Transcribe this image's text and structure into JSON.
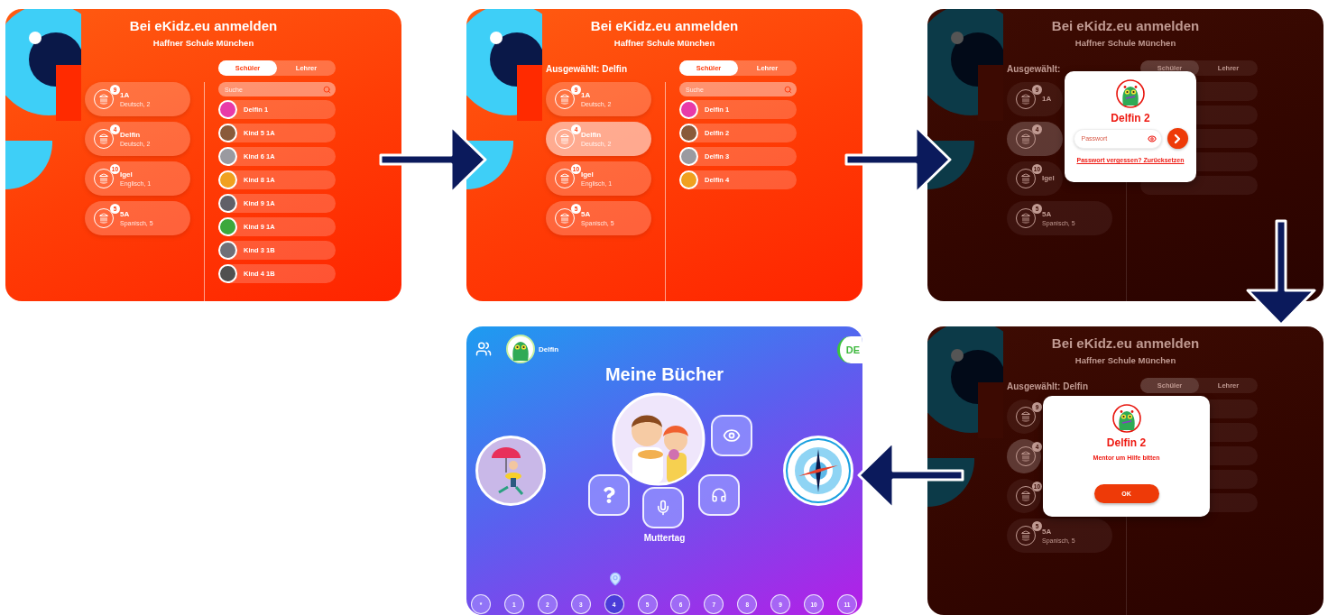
{
  "screens": [
    {
      "kind": "login",
      "dimmed": false,
      "title": "Bei eKidz.eu anmelden",
      "subtitle": "Haffner Schule München",
      "tabs": [
        {
          "label": "Schüler",
          "selected": true
        },
        {
          "label": "Lehrer",
          "selected": false
        }
      ],
      "search": {
        "placeholder": "Suche"
      },
      "classes": [
        {
          "name": "1A",
          "subject": "Deutsch, 2",
          "count": "9",
          "selected": false
        },
        {
          "name": "Delfin",
          "subject": "Deutsch, 2",
          "count": "4",
          "selected": false
        },
        {
          "name": "Igel",
          "subject": "Englisch, 1",
          "count": "10",
          "selected": false
        },
        {
          "name": "5A",
          "subject": "Spanisch, 5",
          "count": "5",
          "selected": false
        }
      ],
      "students": [
        {
          "name": "Delfin 1"
        },
        {
          "name": "Kind 5 1A"
        },
        {
          "name": "Kind 6 1A"
        },
        {
          "name": "Kind 8 1A"
        },
        {
          "name": "Kind 9 1A"
        },
        {
          "name": "Kind 9 1A"
        },
        {
          "name": "Kind 3 1B"
        },
        {
          "name": "Kind 4 1B"
        }
      ]
    },
    {
      "kind": "login",
      "dimmed": false,
      "title": "Bei eKidz.eu anmelden",
      "subtitle": "Haffner Schule München",
      "selected_label": "Ausgewählt: Delfin",
      "tabs": [
        {
          "label": "Schüler",
          "selected": true
        },
        {
          "label": "Lehrer",
          "selected": false
        }
      ],
      "search": {
        "placeholder": "Suche"
      },
      "classes": [
        {
          "name": "1A",
          "subject": "Deutsch, 2",
          "count": "9",
          "selected": false
        },
        {
          "name": "Delfin",
          "subject": "Deutsch, 2",
          "count": "4",
          "selected": true
        },
        {
          "name": "Igel",
          "subject": "Englisch, 1",
          "count": "10",
          "selected": false
        },
        {
          "name": "5A",
          "subject": "Spanisch, 5",
          "count": "5",
          "selected": false
        }
      ],
      "students": [
        {
          "name": "Delfin 1"
        },
        {
          "name": "Delfin 2"
        },
        {
          "name": "Delfin 3"
        },
        {
          "name": "Delfin 4"
        }
      ]
    },
    {
      "kind": "login",
      "dimmed": true,
      "title": "Bei eKidz.eu anmelden",
      "subtitle": "Haffner Schule München",
      "selected_label": "Ausgewählt:",
      "tabs": [
        {
          "label": "Schüler",
          "selected": true
        },
        {
          "label": "Lehrer",
          "selected": false
        }
      ],
      "classes": [
        {
          "name": "1A",
          "count": "9",
          "selected": false
        },
        {
          "count": "4",
          "selected": true
        },
        {
          "name": "Igel",
          "count": "10",
          "selected": false
        },
        {
          "name": "5A",
          "subject": "Spanisch, 5",
          "count": "5",
          "selected": false
        }
      ],
      "dialog": {
        "kind": "password",
        "name": "Delfin 2",
        "password": {
          "placeholder": "Passwort"
        },
        "link": "Passwort vergessen? Zurücksetzen"
      }
    },
    {
      "kind": "login",
      "dimmed": true,
      "title": "Bei eKidz.eu anmelden",
      "subtitle": "Haffner Schule München",
      "selected_label": "Ausgewählt: Delfin",
      "tabs": [
        {
          "label": "Schüler",
          "selected": true
        },
        {
          "label": "Lehrer",
          "selected": false
        }
      ],
      "classes": [
        {
          "count": "9",
          "selected": false
        },
        {
          "count": "4",
          "selected": true
        },
        {
          "count": "10",
          "selected": false
        },
        {
          "name": "5A",
          "subject": "Spanisch, 5",
          "count": "5",
          "selected": false
        }
      ],
      "dialog": {
        "kind": "help",
        "name": "Delfin 2",
        "message": "Mentor um Hilfe bitten",
        "button": "OK"
      }
    },
    {
      "kind": "books",
      "user": {
        "name": "Delfin"
      },
      "language": "DE",
      "title": "Meine Bücher",
      "caption": "Muttertag",
      "pages": [
        {
          "label": "*",
          "selected": false
        },
        {
          "label": "1",
          "selected": false
        },
        {
          "label": "2",
          "selected": false
        },
        {
          "label": "3",
          "selected": false
        },
        {
          "label": "4",
          "selected": true
        },
        {
          "label": "5",
          "selected": false
        },
        {
          "label": "6",
          "selected": false
        },
        {
          "label": "7",
          "selected": false
        },
        {
          "label": "8",
          "selected": false
        },
        {
          "label": "9",
          "selected": false
        },
        {
          "label": "10",
          "selected": false
        },
        {
          "label": "11",
          "selected": false
        }
      ]
    }
  ]
}
